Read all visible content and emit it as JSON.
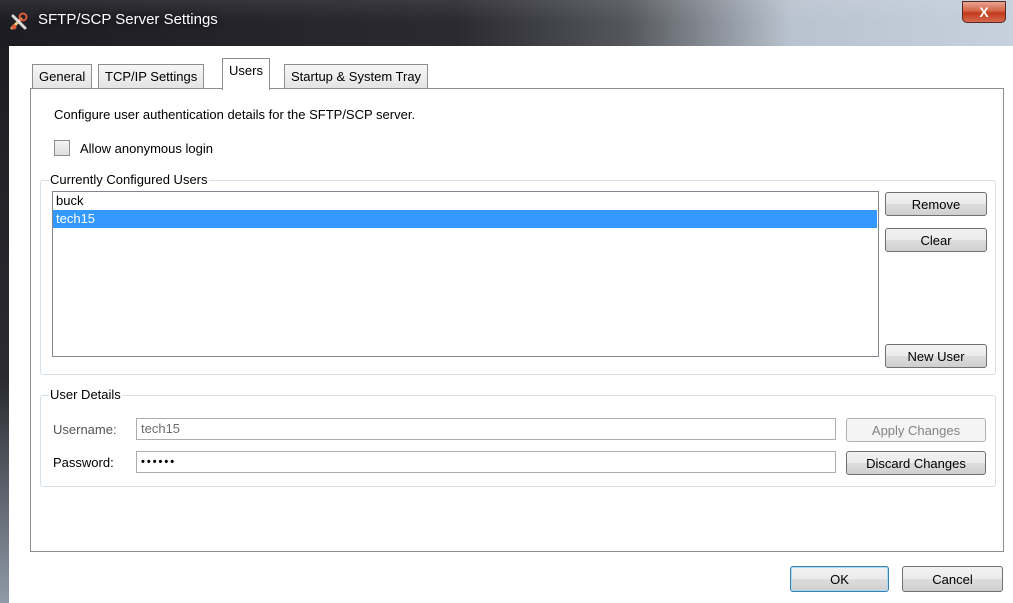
{
  "window": {
    "title": "SFTP/SCP Server Settings",
    "close_label": "X",
    "icon": "tools-app-icon"
  },
  "tabs": [
    {
      "label": "General"
    },
    {
      "label": "TCP/IP Settings"
    },
    {
      "label": "Users",
      "active": true
    },
    {
      "label": "Startup & System Tray"
    }
  ],
  "users_tab": {
    "intro": "Configure user authentication details for the SFTP/SCP server.",
    "anonymous_label": "Allow anonymous login",
    "anonymous_checked": false,
    "configured_users": {
      "title": "Currently Configured Users",
      "items": [
        "buck",
        "tech15"
      ],
      "selected": "tech15",
      "remove_label": "Remove",
      "clear_label": "Clear",
      "new_user_label": "New User"
    },
    "user_details": {
      "title": "User Details",
      "username_label": "Username:",
      "username_value": "tech15",
      "password_label": "Password:",
      "password_value": "••••••",
      "apply_label": "Apply Changes",
      "discard_label": "Discard Changes"
    }
  },
  "footer": {
    "ok_label": "OK",
    "cancel_label": "Cancel"
  },
  "colors": {
    "selection": "#3399ff",
    "close_button": "#c2391c"
  }
}
